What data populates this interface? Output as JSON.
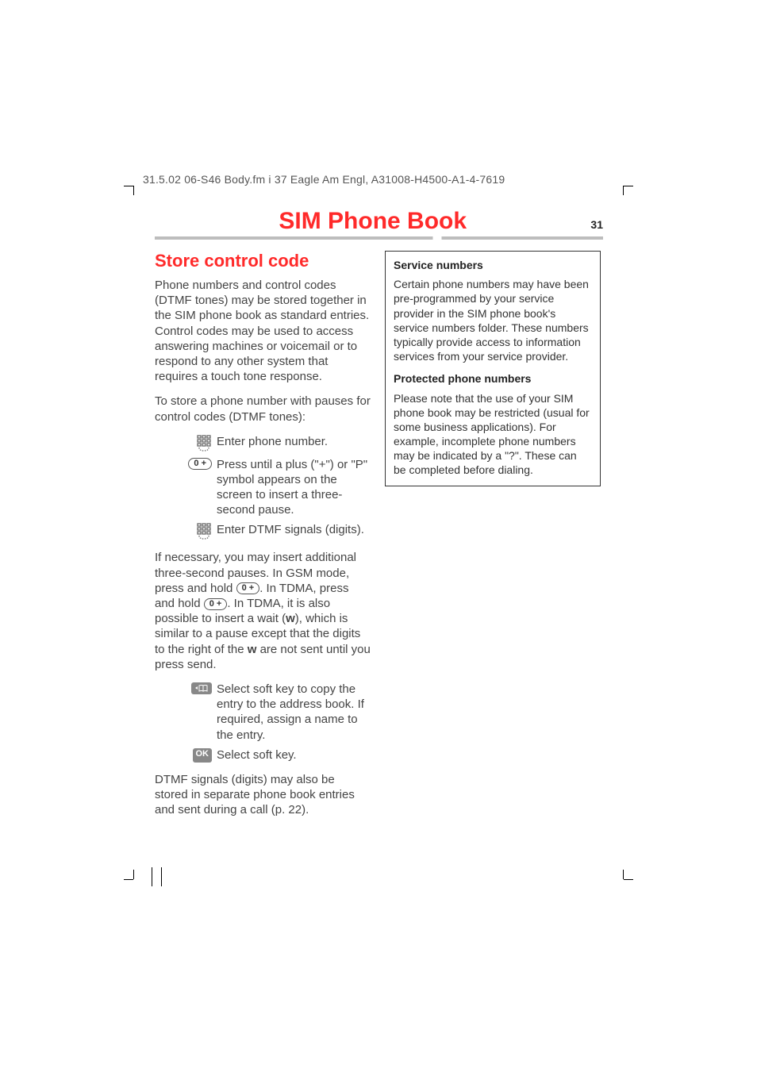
{
  "header": "31.5.02   06-S46 Body.fm   i 37 Eagle  Am Engl, A31008-H4500-A1-4-7619",
  "title": "SIM Phone Book",
  "pageNumber": "31",
  "section": {
    "heading": "Store control code",
    "p1": "Phone numbers and control codes (DTMF tones) may be stored together in the SIM phone book as standard entries. Control codes may be used to access answering machines or voicemail or to respond to any other system that requires a touch tone response.",
    "p2": "To store a phone number with pauses for control codes (DTMF tones):",
    "steps": {
      "s1": "Enter phone number.",
      "s2": "Press until a plus (\"+\") or \"P\" symbol appears on the screen to insert a three-second pause.",
      "s3": "Enter DTMF signals (digits)."
    },
    "p3_a": "If necessary, you may insert additional three-second pauses. In GSM mode, press and hold ",
    "p3_b": ". In TDMA, press and hold ",
    "p3_c": ". In TDMA, it is also possible to insert a wait (",
    "p3_d": "), which is similar to a pause except that the digits to the right of the ",
    "p3_e": " are not sent until you press send.",
    "w": "w",
    "inlineKey": "0 +",
    "steps2": {
      "s4": "Select soft key to copy the entry to the address book. If required, assign a name to the entry.",
      "s5": "Select soft key."
    },
    "ok": "OK",
    "p4": "DTMF signals (digits) may also be stored in separate phone book entries and sent during a call (p. 22)."
  },
  "box": {
    "h1": "Service numbers",
    "p1": "Certain phone numbers may have been pre-programmed by your service provider in the SIM phone book's service numbers folder. These numbers typically provide access to information services from your service provider.",
    "h2": "Protected phone numbers",
    "p2": "Please note that the use of your SIM phone book may be restricted (usual for some business applications). For example, incomplete phone numbers may be indicated by a \"?\". These can be completed before dialing."
  }
}
